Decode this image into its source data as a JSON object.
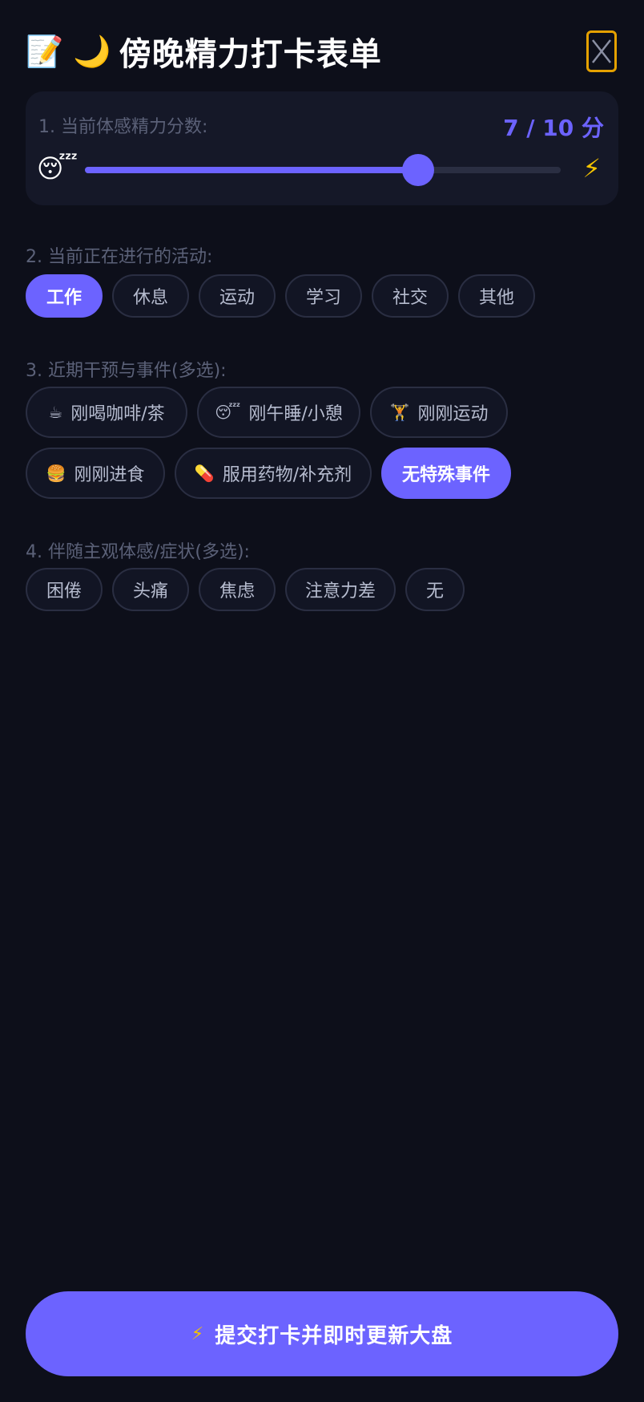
{
  "header": {
    "emoji": "📝 🌙",
    "title": "傍晚精力打卡表单",
    "close_icon": "close-icon",
    "accent_color": "#e5a100"
  },
  "energy": {
    "label": "1. 当前体感精力分数:",
    "score_text": "7 / 10 分",
    "value": 7,
    "max": 10,
    "low_emoji": "😴",
    "high_emoji": "⚡"
  },
  "activity": {
    "label": "2. 当前正在进行的活动:",
    "options": [
      {
        "label": "工作",
        "selected": true
      },
      {
        "label": "休息",
        "selected": false
      },
      {
        "label": "运动",
        "selected": false
      },
      {
        "label": "学习",
        "selected": false
      },
      {
        "label": "社交",
        "selected": false
      },
      {
        "label": "其他",
        "selected": false
      }
    ]
  },
  "events": {
    "label": "3. 近期干预与事件(多选):",
    "options": [
      {
        "emoji": "☕",
        "label": "刚喝咖啡/茶",
        "selected": false
      },
      {
        "emoji": "😴",
        "label": "刚午睡/小憩",
        "selected": false
      },
      {
        "emoji": "🏋",
        "label": "刚刚运动",
        "selected": false
      },
      {
        "emoji": "🍔",
        "label": "刚刚进食",
        "selected": false
      },
      {
        "emoji": "💊",
        "label": "服用药物/补充剂",
        "selected": false
      },
      {
        "emoji": "",
        "label": "无特殊事件",
        "selected": true
      }
    ]
  },
  "symptoms": {
    "label": "4. 伴随主观体感/症状(多选):",
    "options": [
      {
        "label": "困倦",
        "selected": false
      },
      {
        "label": "头痛",
        "selected": false
      },
      {
        "label": "焦虑",
        "selected": false
      },
      {
        "label": "注意力差",
        "selected": false
      },
      {
        "label": "无",
        "selected": false
      }
    ]
  },
  "submit": {
    "emoji": "⚡",
    "label": "提交打卡并即时更新大盘"
  },
  "colors": {
    "background": "#0d0f1a",
    "card": "#151828",
    "accent": "#6c63ff",
    "muted_text": "#5b6178",
    "pill_text": "#b6bccf"
  }
}
